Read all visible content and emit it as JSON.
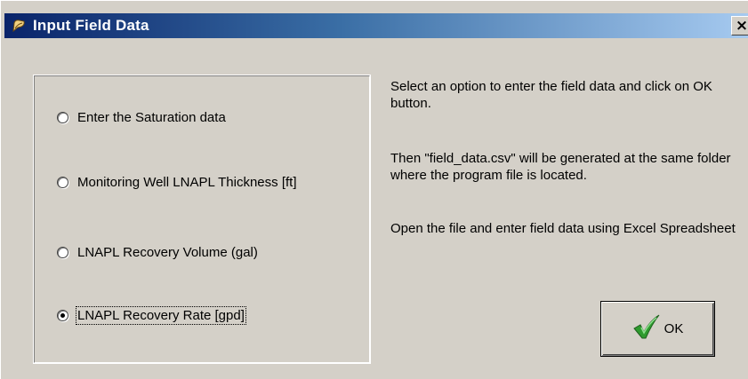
{
  "window": {
    "title": "Input Field Data",
    "close_glyph": "×"
  },
  "options": [
    {
      "label": "Enter the Saturation data",
      "checked": false
    },
    {
      "label": "Monitoring Well LNAPL Thickness [ft]",
      "checked": false
    },
    {
      "label": "LNAPL Recovery Volume (gal)",
      "checked": false
    },
    {
      "label": "LNAPL Recovery Rate [gpd]",
      "checked": true
    }
  ],
  "instructions": {
    "line1": "Select an option to enter the field data and click on OK button.",
    "line2": "Then \"field_data.csv\" will be generated at the same folder where the program file is located.",
    "line3": " Open the file and enter field data using Excel Spreadsheet"
  },
  "ok_button": {
    "label": "OK",
    "icon": "checkmark-icon"
  },
  "colors": {
    "titlebar_start": "#0a246a",
    "titlebar_end": "#a6caf0",
    "face": "#d4d0c8",
    "check_green": "#2e9a2e"
  }
}
